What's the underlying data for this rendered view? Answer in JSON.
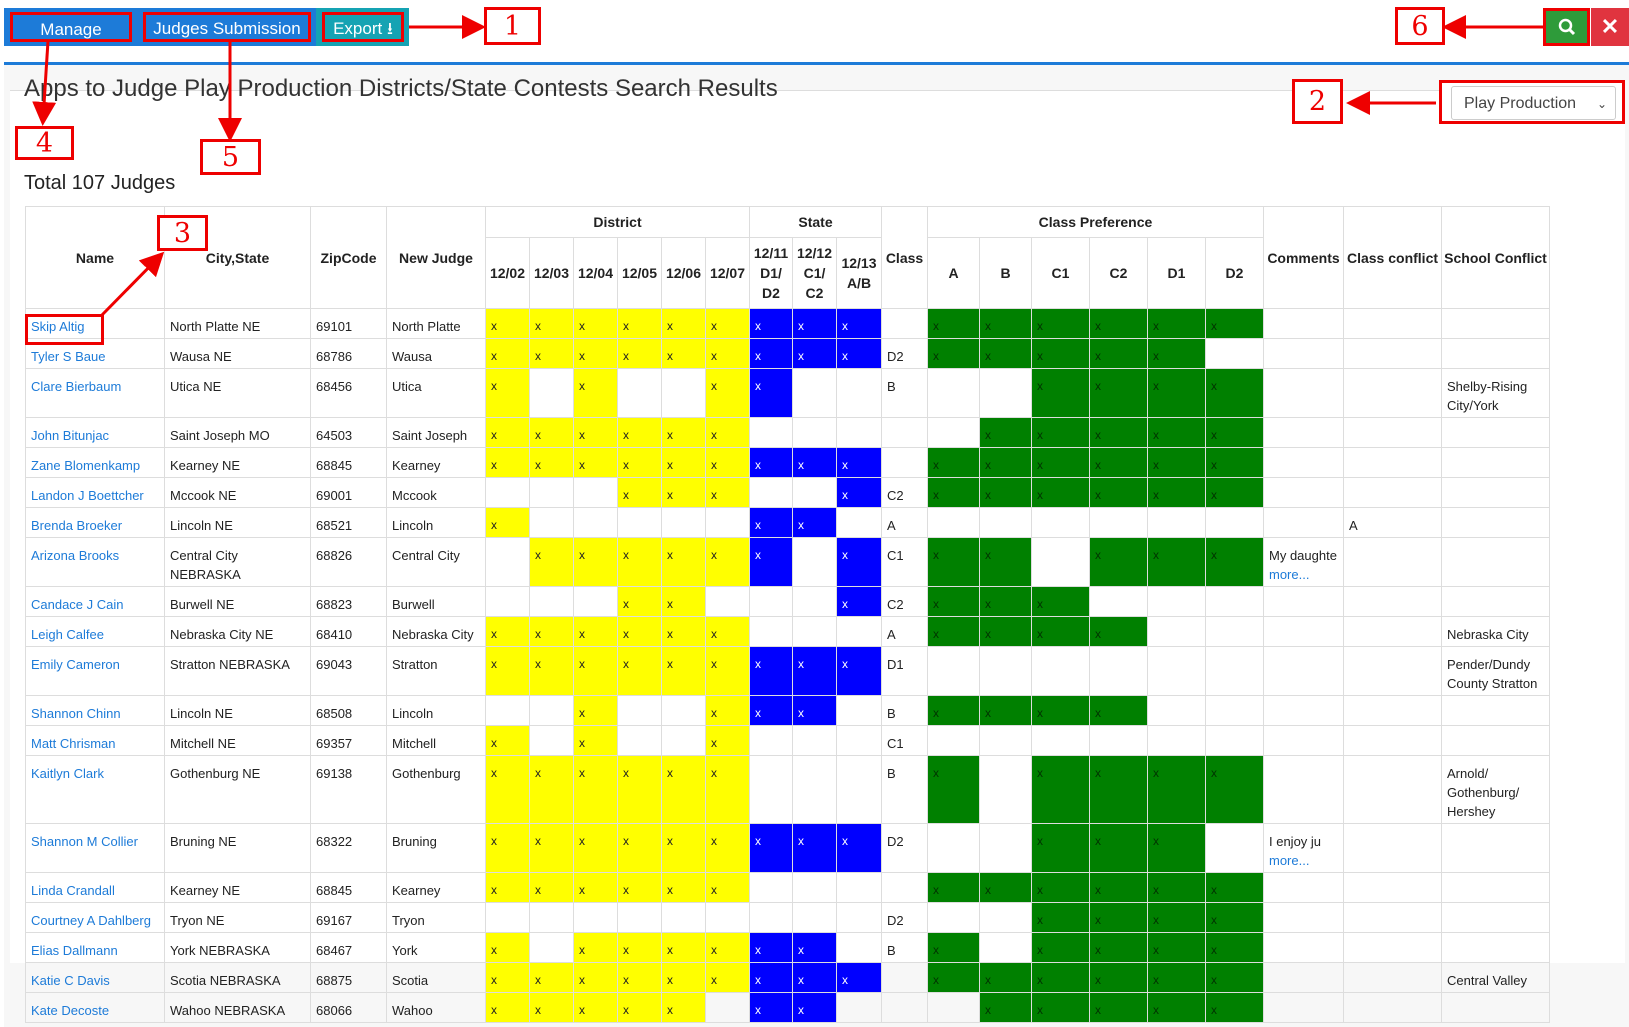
{
  "toolbar": {
    "manage_zones": "Manage Zones",
    "judges_submission": "Judges Submission",
    "export": "Export"
  },
  "page": {
    "title": "Apps to Judge Play Production Districts/State Contests Search Results",
    "total": "Total 107 Judges",
    "contest_select": "Play Production"
  },
  "annotations": [
    "1",
    "2",
    "3",
    "4",
    "5",
    "6"
  ],
  "table": {
    "headers": {
      "name": "Name",
      "city_state": "City,State",
      "zip": "ZipCode",
      "new_judge": "New Judge",
      "district": "District",
      "state": "State",
      "class": "Class",
      "class_pref": "Class Preference",
      "comments": "Comments",
      "class_conflict": "Class conflict",
      "school_conflict": "School Conflict"
    },
    "district_cols": [
      "12/02",
      "12/03",
      "12/04",
      "12/05",
      "12/06",
      "12/07"
    ],
    "state_cols": [
      "12/11 D1/ D2",
      "12/12 C1/ C2",
      "12/13 A/B"
    ],
    "pref_cols": [
      "A",
      "B",
      "C1",
      "C2",
      "D1",
      "D2"
    ],
    "rows": [
      {
        "name": "Skip Altig",
        "city": "North Platte NE",
        "zip": "69101",
        "newjudge": "North Platte",
        "district": [
          1,
          1,
          1,
          1,
          1,
          1
        ],
        "state": [
          1,
          1,
          1
        ],
        "class": "",
        "pref": [
          1,
          1,
          1,
          1,
          1,
          1
        ],
        "comment": "",
        "more": "",
        "classconf": "",
        "school": ""
      },
      {
        "name": "Tyler S Baue",
        "city": "Wausa NE",
        "zip": "68786",
        "newjudge": "Wausa",
        "district": [
          1,
          1,
          1,
          1,
          1,
          1
        ],
        "state": [
          1,
          1,
          1
        ],
        "class": "D2",
        "pref": [
          1,
          1,
          1,
          1,
          1,
          0
        ],
        "comment": "",
        "more": "",
        "classconf": "",
        "school": ""
      },
      {
        "name": "Clare Bierbaum",
        "city": "Utica NE",
        "zip": "68456",
        "newjudge": "Utica",
        "district": [
          1,
          0,
          1,
          0,
          0,
          1
        ],
        "state": [
          1,
          0,
          0
        ],
        "class": "B",
        "pref": [
          0,
          0,
          1,
          1,
          1,
          1
        ],
        "comment": "",
        "more": "",
        "classconf": "",
        "school": "Shelby-Rising City/York"
      },
      {
        "name": "John Bitunjac",
        "city": "Saint Joseph MO",
        "zip": "64503",
        "newjudge": "Saint Joseph",
        "district": [
          1,
          1,
          1,
          1,
          1,
          1
        ],
        "state": [
          0,
          0,
          0
        ],
        "class": "",
        "pref": [
          0,
          1,
          1,
          1,
          1,
          1
        ],
        "comment": "",
        "more": "",
        "classconf": "",
        "school": ""
      },
      {
        "name": "Zane Blomenkamp",
        "city": "Kearney NE",
        "zip": "68845",
        "newjudge": "Kearney",
        "district": [
          1,
          1,
          1,
          1,
          1,
          1
        ],
        "state": [
          1,
          1,
          1
        ],
        "class": "",
        "pref": [
          1,
          1,
          1,
          1,
          1,
          1
        ],
        "comment": "",
        "more": "",
        "classconf": "",
        "school": ""
      },
      {
        "name": "Landon J Boettcher",
        "city": "Mccook NE",
        "zip": "69001",
        "newjudge": "Mccook",
        "district": [
          0,
          0,
          0,
          1,
          1,
          1
        ],
        "state": [
          0,
          0,
          1
        ],
        "class": "C2",
        "pref": [
          1,
          1,
          1,
          1,
          1,
          1
        ],
        "comment": "",
        "more": "",
        "classconf": "",
        "school": ""
      },
      {
        "name": "Brenda Broeker",
        "city": "Lincoln NE",
        "zip": "68521",
        "newjudge": "Lincoln",
        "district": [
          1,
          0,
          0,
          0,
          0,
          0
        ],
        "state": [
          1,
          1,
          0
        ],
        "class": "A",
        "pref": [
          0,
          0,
          0,
          0,
          0,
          0
        ],
        "comment": "",
        "more": "",
        "classconf": "A",
        "school": ""
      },
      {
        "name": "Arizona Brooks",
        "city": "Central City NEBRASKA",
        "zip": "68826",
        "newjudge": "Central City",
        "district": [
          0,
          1,
          1,
          1,
          1,
          1
        ],
        "state": [
          1,
          0,
          1
        ],
        "class": "C1",
        "pref": [
          1,
          1,
          0,
          1,
          1,
          1
        ],
        "comment": "My daughte",
        "more": "more...",
        "classconf": "",
        "school": ""
      },
      {
        "name": "Candace J Cain",
        "city": "Burwell NE",
        "zip": "68823",
        "newjudge": "Burwell",
        "district": [
          0,
          0,
          0,
          1,
          1,
          0
        ],
        "state": [
          0,
          0,
          1
        ],
        "class": "C2",
        "pref": [
          1,
          1,
          1,
          0,
          0,
          0
        ],
        "comment": "",
        "more": "",
        "classconf": "",
        "school": ""
      },
      {
        "name": "Leigh Calfee",
        "city": "Nebraska City NE",
        "zip": "68410",
        "newjudge": "Nebraska City",
        "district": [
          1,
          1,
          1,
          1,
          1,
          1
        ],
        "state": [
          0,
          0,
          0
        ],
        "class": "A",
        "pref": [
          1,
          1,
          1,
          1,
          0,
          0
        ],
        "comment": "",
        "more": "",
        "classconf": "",
        "school": "Nebraska City"
      },
      {
        "name": "Emily Cameron",
        "city": "Stratton NEBRASKA",
        "zip": "69043",
        "newjudge": "Stratton",
        "district": [
          1,
          1,
          1,
          1,
          1,
          1
        ],
        "state": [
          1,
          1,
          1
        ],
        "class": "D1",
        "pref": [
          0,
          0,
          0,
          0,
          0,
          0
        ],
        "comment": "",
        "more": "",
        "classconf": "",
        "school": "Pender/Dundy County Stratton"
      },
      {
        "name": "Shannon Chinn",
        "city": "Lincoln NE",
        "zip": "68508",
        "newjudge": "Lincoln",
        "district": [
          0,
          0,
          1,
          0,
          0,
          1
        ],
        "state": [
          1,
          1,
          0
        ],
        "class": "B",
        "pref": [
          1,
          1,
          1,
          1,
          0,
          0
        ],
        "comment": "",
        "more": "",
        "classconf": "",
        "school": ""
      },
      {
        "name": "Matt Chrisman",
        "city": "Mitchell NE",
        "zip": "69357",
        "newjudge": "Mitchell",
        "district": [
          1,
          0,
          1,
          0,
          0,
          1
        ],
        "state": [
          0,
          0,
          0
        ],
        "class": "C1",
        "pref": [
          0,
          0,
          0,
          0,
          0,
          0
        ],
        "comment": "",
        "more": "",
        "classconf": "",
        "school": ""
      },
      {
        "name": "Kaitlyn Clark",
        "city": "Gothenburg NE",
        "zip": "69138",
        "newjudge": "Gothenburg",
        "district": [
          1,
          1,
          1,
          1,
          1,
          1
        ],
        "state": [
          0,
          0,
          0
        ],
        "class": "B",
        "pref": [
          1,
          0,
          1,
          1,
          1,
          1
        ],
        "comment": "",
        "more": "",
        "classconf": "",
        "school": "Arnold/ Gothenburg/ Hershey"
      },
      {
        "name": "Shannon M Collier",
        "city": "Bruning NE",
        "zip": "68322",
        "newjudge": "Bruning",
        "district": [
          1,
          1,
          1,
          1,
          1,
          1
        ],
        "state": [
          1,
          1,
          1
        ],
        "class": "D2",
        "pref": [
          0,
          0,
          1,
          1,
          1,
          0
        ],
        "comment": "I enjoy ju",
        "more": "more...",
        "classconf": "",
        "school": ""
      },
      {
        "name": "Linda Crandall",
        "city": "Kearney NE",
        "zip": "68845",
        "newjudge": "Kearney",
        "district": [
          1,
          1,
          1,
          1,
          1,
          1
        ],
        "state": [
          0,
          0,
          0
        ],
        "class": "",
        "pref": [
          1,
          1,
          1,
          1,
          1,
          1
        ],
        "comment": "",
        "more": "",
        "classconf": "",
        "school": ""
      },
      {
        "name": "Courtney A Dahlberg",
        "city": "Tryon NE",
        "zip": "69167",
        "newjudge": "Tryon",
        "district": [
          0,
          0,
          0,
          0,
          0,
          0
        ],
        "state": [
          0,
          0,
          0
        ],
        "class": "D2",
        "pref": [
          0,
          0,
          1,
          1,
          1,
          1
        ],
        "comment": "",
        "more": "",
        "classconf": "",
        "school": ""
      },
      {
        "name": "Elias Dallmann",
        "city": "York NEBRASKA",
        "zip": "68467",
        "newjudge": "York",
        "district": [
          1,
          0,
          1,
          1,
          1,
          1
        ],
        "state": [
          1,
          1,
          0
        ],
        "class": "B",
        "pref": [
          1,
          0,
          1,
          1,
          1,
          1
        ],
        "comment": "",
        "more": "",
        "classconf": "",
        "school": ""
      },
      {
        "name": "Katie C Davis",
        "city": "Scotia NEBRASKA",
        "zip": "68875",
        "newjudge": "Scotia",
        "district": [
          1,
          1,
          1,
          1,
          1,
          1
        ],
        "state": [
          1,
          1,
          1
        ],
        "class": "",
        "pref": [
          1,
          1,
          1,
          1,
          1,
          1
        ],
        "comment": "",
        "more": "",
        "classconf": "",
        "school": "Central Valley"
      },
      {
        "name": "Kate Decoste",
        "city": "Wahoo NEBRASKA",
        "zip": "68066",
        "newjudge": "Wahoo",
        "district": [
          1,
          1,
          1,
          1,
          1,
          0
        ],
        "state": [
          1,
          1,
          0
        ],
        "class": "",
        "pref": [
          0,
          1,
          1,
          1,
          1,
          1
        ],
        "comment": "",
        "more": "",
        "classconf": "",
        "school": ""
      }
    ],
    "mark": "x"
  },
  "colors": {
    "toolbar": "#1d7bd8",
    "export": "#15a3b3",
    "search": "#2e9b3a",
    "close": "#e0343f",
    "district_fill": "#ffff00",
    "state_fill": "#0000ff",
    "pref_fill": "#008000",
    "annotation": "#ee0000"
  }
}
